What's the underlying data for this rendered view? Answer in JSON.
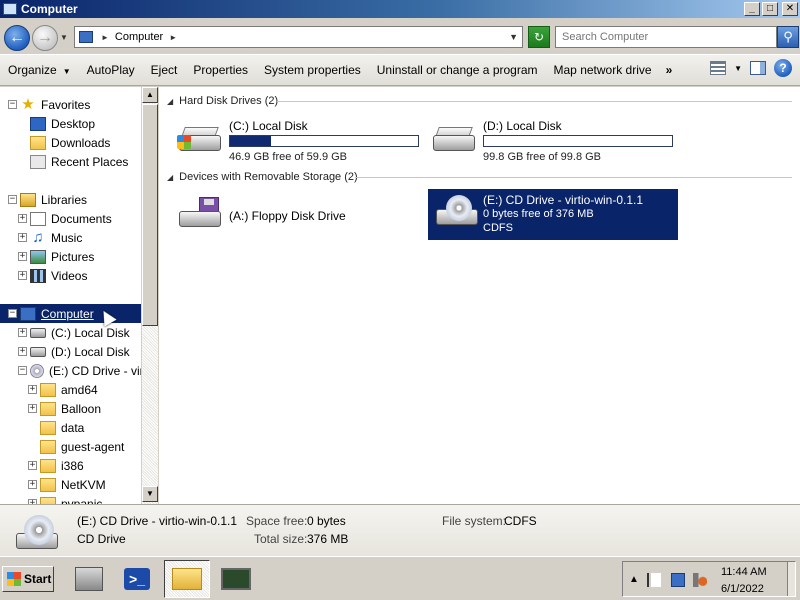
{
  "window": {
    "title": "Computer"
  },
  "window_buttons": {
    "minimize": "_",
    "maximize": "□",
    "close": "✕"
  },
  "address_bar": {
    "path": "Computer",
    "search_placeholder": "Search Computer"
  },
  "toolbar": {
    "items": [
      "Organize",
      "AutoPlay",
      "Eject",
      "Properties",
      "System properties",
      "Uninstall or change a program",
      "Map network drive"
    ],
    "more": "»"
  },
  "nav": {
    "favorites": {
      "label": "Favorites",
      "items": [
        "Desktop",
        "Downloads",
        "Recent Places"
      ]
    },
    "libraries": {
      "label": "Libraries",
      "items": [
        "Documents",
        "Music",
        "Pictures",
        "Videos"
      ]
    },
    "computer": {
      "label": "Computer",
      "items": [
        "(C:) Local Disk",
        "(D:) Local Disk",
        "(E:) CD Drive - virti"
      ]
    },
    "cd_folders": [
      "amd64",
      "Balloon",
      "data",
      "guest-agent",
      "i386",
      "NetKVM",
      "pvpanic"
    ]
  },
  "content": {
    "group_hdd": "Hard Disk Drives (2)",
    "group_removable": "Devices with Removable Storage (2)",
    "drives": {
      "c": {
        "name": "(C:) Local Disk",
        "free": "46.9 GB free of 59.9 GB",
        "used_fraction": 0.22
      },
      "d": {
        "name": "(D:) Local Disk",
        "free": "99.8 GB free of 99.8 GB",
        "used_fraction": 0.0
      },
      "a": {
        "name": "(A:) Floppy Disk Drive"
      },
      "e": {
        "name": "(E:) CD Drive - virtio-win-0.1.1",
        "free": "0 bytes free of 376 MB",
        "fs": "CDFS"
      }
    }
  },
  "details": {
    "name": "(E:) CD Drive - virtio-win-0.1.1",
    "type": "CD Drive",
    "space_free_label": "Space free:",
    "space_free": "0 bytes",
    "total_size_label": "Total size:",
    "total_size": "376 MB",
    "fs_label": "File system:",
    "fs": "CDFS"
  },
  "taskbar": {
    "start": "Start",
    "time": "11:44 AM",
    "date": "6/1/2022"
  },
  "colors": {
    "selection": "#0a246a",
    "drive_bar_fill": "#102a72",
    "title_gradient_start": "#0a246a"
  }
}
